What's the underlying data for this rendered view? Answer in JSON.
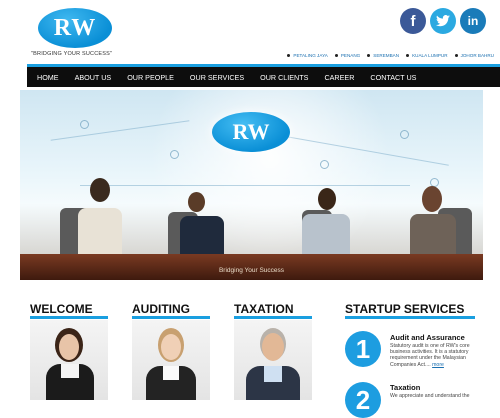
{
  "header": {
    "logo_text": "RW",
    "tagline": "\"BRIDGING YOUR SUCCESS\"",
    "social": [
      {
        "label": "f",
        "icon": "facebook-icon"
      },
      {
        "label": "t",
        "icon": "twitter-icon"
      },
      {
        "label": "in",
        "icon": "linkedin-icon"
      }
    ],
    "locations": [
      "PETALING JAYA",
      "PENANG",
      "SEREMBAN",
      "KUALA LUMPUR",
      "JOHOR BAHRU"
    ]
  },
  "nav": {
    "items": [
      "HOME",
      "ABOUT US",
      "OUR PEOPLE",
      "OUR SERVICES",
      "OUR CLIENTS",
      "CAREER",
      "CONTACT US"
    ]
  },
  "hero": {
    "logo_text": "RW",
    "caption": "Bridging Your Success"
  },
  "sections": {
    "welcome": "WELCOME",
    "auditing": "AUDITING",
    "taxation": "TAXATION",
    "startup": "STARTUP SERVICES"
  },
  "startup_services": [
    {
      "number": "1",
      "title": "Audit and Assurance",
      "text": "Statutory audit is one of RW's core business activities. It is a statutory requirement under the Malaysian Companies Act....",
      "more": "more"
    },
    {
      "number": "2",
      "title": "Taxation",
      "text": "We appreciate and understand the"
    }
  ],
  "colors": {
    "accent": "#1a9fe0",
    "nav_bg": "#0d0d0d",
    "facebook": "#3b5998",
    "twitter": "#2ba9e1",
    "linkedin": "#1a7bb9"
  }
}
